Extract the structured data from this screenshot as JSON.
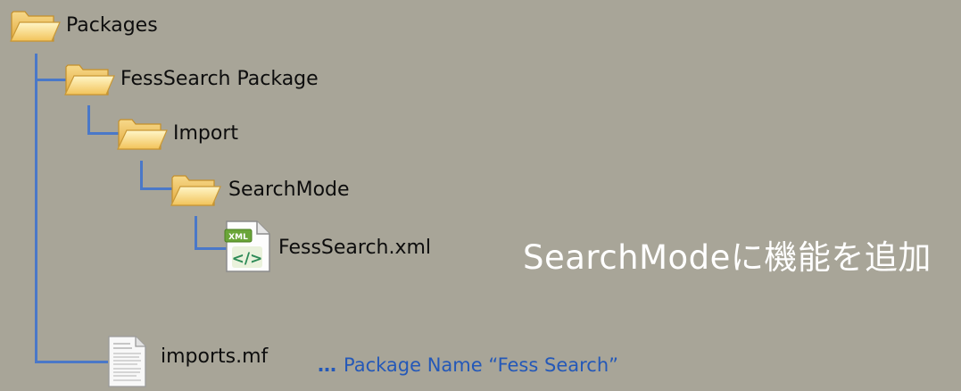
{
  "tree": {
    "root": {
      "label": "Packages",
      "icon": "folder-icon"
    },
    "package": {
      "label": "FessSearch Package",
      "icon": "folder-icon"
    },
    "import": {
      "label": "Import",
      "icon": "folder-icon"
    },
    "search_mode": {
      "label": "SearchMode",
      "icon": "folder-icon"
    },
    "xml_file": {
      "label": "FessSearch.xml",
      "icon": "xml-file-icon",
      "badge": "XML",
      "glyph": "</>"
    },
    "manifest": {
      "label": "imports.mf",
      "icon": "document-icon"
    }
  },
  "annotation": {
    "text": "SearchModeに機能を追加"
  },
  "manifest_note": {
    "dots": "…",
    "text": "Package Name “Fess Search”"
  },
  "colors": {
    "background": "#a8a598",
    "connector": "#4a78c8",
    "note": "#2458b8",
    "annotation": "#ffffff"
  }
}
